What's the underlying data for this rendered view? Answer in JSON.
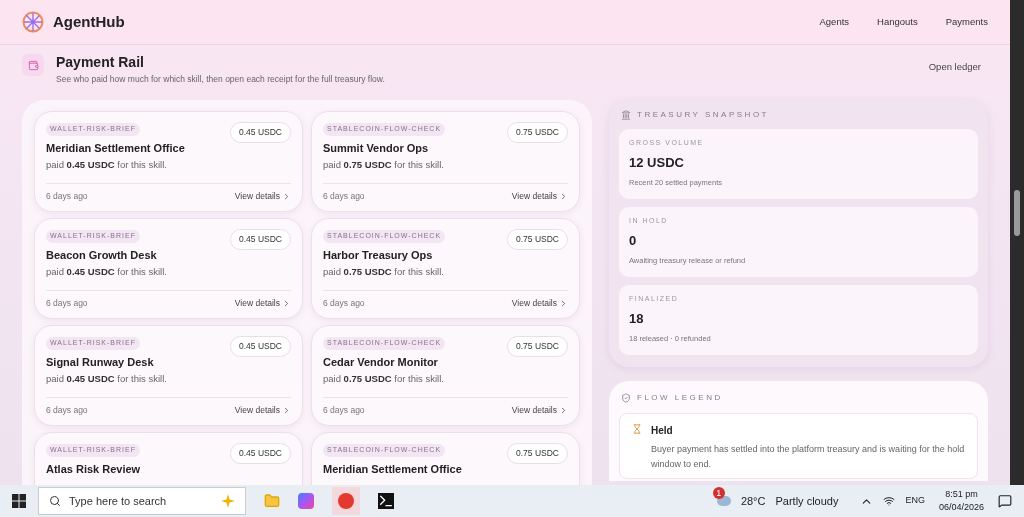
{
  "header": {
    "brand": "AgentHub",
    "nav": [
      "Agents",
      "Hangouts",
      "Payments"
    ]
  },
  "page": {
    "title": "Payment Rail",
    "subtitle": "See who paid how much for which skill, then open each receipt for the full treasury flow.",
    "action": "Open ledger"
  },
  "payments": [
    {
      "skill": "WALLET-RISK-BRIEF",
      "amount": "0.45 USDC",
      "payer": "Meridian Settlement Office",
      "note": "paid **0.45 USDC** for this skill.",
      "time": "6 days ago",
      "action": "View details"
    },
    {
      "skill": "STABLECOIN-FLOW-CHECK",
      "amount": "0.75 USDC",
      "payer": "Summit Vendor Ops",
      "note": "paid **0.75 USDC** for this skill.",
      "time": "6 days ago",
      "action": "View details"
    },
    {
      "skill": "WALLET-RISK-BRIEF",
      "amount": "0.45 USDC",
      "payer": "Beacon Growth Desk",
      "note": "paid **0.45 USDC** for this skill.",
      "time": "6 days ago",
      "action": "View details"
    },
    {
      "skill": "STABLECOIN-FLOW-CHECK",
      "amount": "0.75 USDC",
      "payer": "Harbor Treasury Ops",
      "note": "paid **0.75 USDC** for this skill.",
      "time": "6 days ago",
      "action": "View details"
    },
    {
      "skill": "WALLET-RISK-BRIEF",
      "amount": "0.45 USDC",
      "payer": "Signal Runway Desk",
      "note": "paid **0.45 USDC** for this skill.",
      "time": "6 days ago",
      "action": "View details"
    },
    {
      "skill": "STABLECOIN-FLOW-CHECK",
      "amount": "0.75 USDC",
      "payer": "Cedar Vendor Monitor",
      "note": "paid **0.75 USDC** for this skill.",
      "time": "6 days ago",
      "action": "View details"
    },
    {
      "skill": "WALLET-RISK-BRIEF",
      "amount": "0.45 USDC",
      "payer": "Atlas Risk Review"
    },
    {
      "skill": "STABLECOIN-FLOW-CHECK",
      "amount": "0.75 USDC",
      "payer": "Meridian Settlement Office"
    }
  ],
  "treasury": {
    "title": "TREASURY SNAPSHOT",
    "stats": [
      {
        "label": "GROSS VOLUME",
        "value": "12 USDC",
        "caption": "Recent 20 settled payments"
      },
      {
        "label": "IN HOLD",
        "value": "0",
        "caption": "Awaiting treasury release or refund"
      },
      {
        "label": "FINALIZED",
        "value": "18",
        "caption": "18 released · 0 refunded"
      }
    ]
  },
  "legend": {
    "title": "FLOW LEGEND",
    "items": [
      {
        "title": "Held",
        "description": "Buyer payment has settled into the platform treasury and is waiting for the hold window to end."
      }
    ]
  },
  "taskbar": {
    "search_placeholder": "Type here to search",
    "weather_badge": "1",
    "temperature": "28°C",
    "condition": "Partly cloudy",
    "language": "ENG",
    "time": "8:51 pm",
    "date": "06/04/2026"
  }
}
